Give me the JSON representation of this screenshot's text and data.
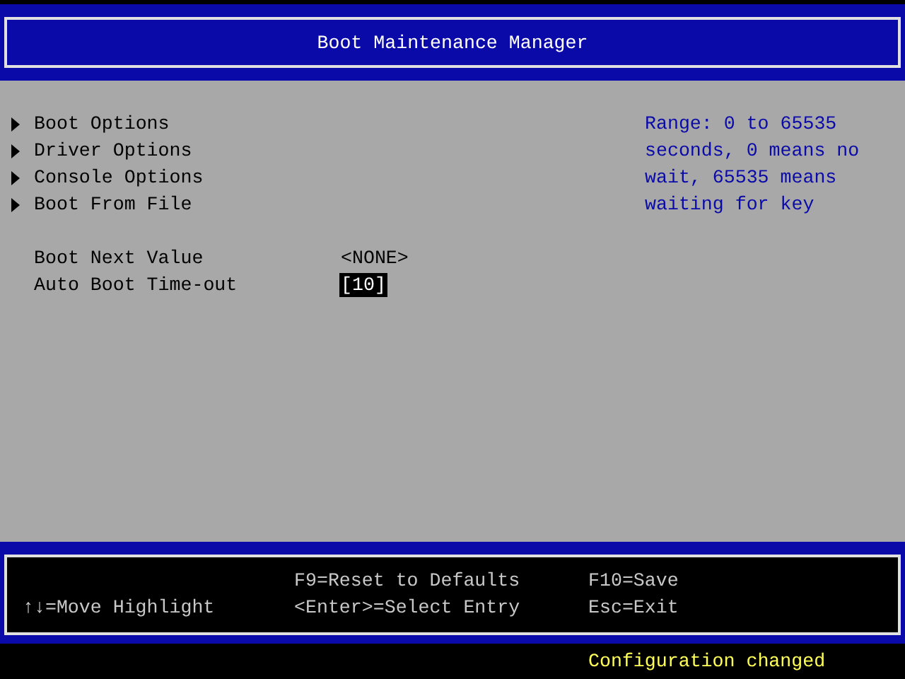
{
  "header": {
    "title": "Boot Maintenance Manager"
  },
  "menu": [
    {
      "kind": "submenu",
      "label": "Boot Options",
      "selected": false
    },
    {
      "kind": "submenu",
      "label": "Driver Options",
      "selected": false
    },
    {
      "kind": "submenu",
      "label": "Console Options",
      "selected": false
    },
    {
      "kind": "submenu",
      "label": "Boot From File",
      "selected": false
    },
    {
      "kind": "spacer"
    },
    {
      "kind": "value",
      "label": "Boot Next Value",
      "value": "<NONE>",
      "selected": false
    },
    {
      "kind": "value",
      "label": "Auto Boot Time-out",
      "value": "[10]",
      "selected": true
    }
  ],
  "help": [
    "Range: 0 to 65535",
    "seconds, 0 means no",
    "wait, 65535 means",
    "waiting for key"
  ],
  "footer": {
    "columns": [
      [
        "↑↓=Move Highlight"
      ],
      [
        "F9=Reset to Defaults",
        "<Enter>=Select Entry"
      ],
      [
        "F10=Save",
        "Esc=Exit"
      ]
    ]
  },
  "status": "Configuration changed"
}
